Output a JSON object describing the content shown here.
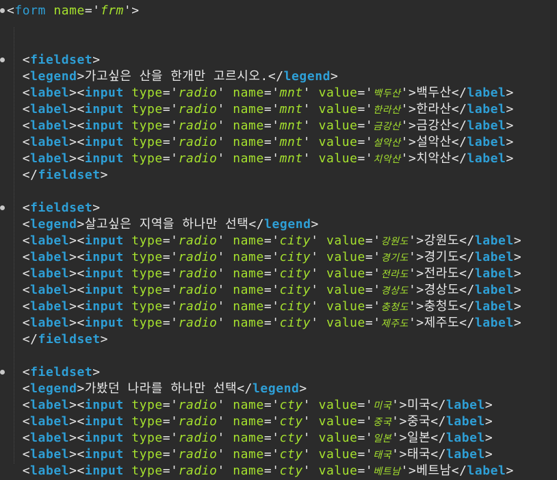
{
  "form": {
    "tag": "form",
    "attr_name": "name",
    "name": "frm"
  },
  "fieldsets": [
    {
      "legend": "가고싶은 산을 한개만 고르시오.",
      "input_name": "mnt",
      "options": [
        {
          "value": "백두산",
          "label": "백두산"
        },
        {
          "value": "한라산",
          "label": "한라산"
        },
        {
          "value": "금강산",
          "label": "금강산"
        },
        {
          "value": "설악산",
          "label": "설악산"
        },
        {
          "value": "치악산",
          "label": "치악산"
        }
      ]
    },
    {
      "legend": "살고싶은 지역을 하나만 선택",
      "input_name": "city",
      "options": [
        {
          "value": "강원도",
          "label": "강원도"
        },
        {
          "value": "경기도",
          "label": "경기도"
        },
        {
          "value": "전라도",
          "label": "전라도"
        },
        {
          "value": "경상도",
          "label": "경상도"
        },
        {
          "value": "충청도",
          "label": "충청도"
        },
        {
          "value": "제주도",
          "label": "제주도"
        }
      ]
    },
    {
      "legend": "가봤던 나라를 하나만 선택",
      "input_name": "cty",
      "options": [
        {
          "value": "미국",
          "label": "미국"
        },
        {
          "value": "중국",
          "label": "중국"
        },
        {
          "value": "일본",
          "label": "일본"
        },
        {
          "value": "태국",
          "label": "태국"
        },
        {
          "value": "베트남",
          "label": "베트남"
        }
      ]
    }
  ],
  "syntax": {
    "fieldset": "fieldset",
    "legend": "legend",
    "label": "label",
    "input": "input",
    "type_attr": "type",
    "name_attr": "name",
    "value_attr": "value",
    "type_value": "radio"
  },
  "colors": {
    "background": "#2b2b2b",
    "tag": "#2e9fd6",
    "attribute": "#a6e22e",
    "punctuation": "#e8e8e8"
  }
}
